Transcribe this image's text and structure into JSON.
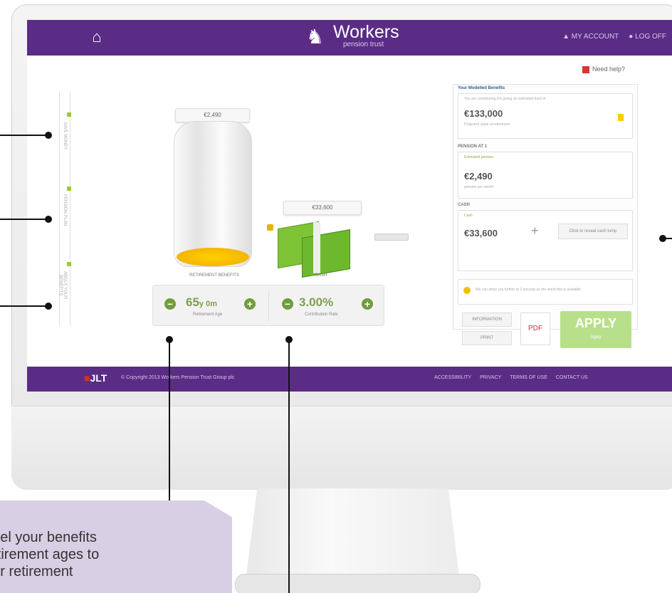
{
  "header": {
    "home_icon": "home-icon",
    "logo_main": "Workers",
    "logo_sub": "pension trust",
    "my_account": "▲ MY ACCOUNT",
    "log_off": "● LOG OFF"
  },
  "help": {
    "label": "Need help?"
  },
  "sidebar": {
    "items": [
      "SAVE MONEY",
      "PENSION PLAN",
      "ABOUT YOUR BENEFITS"
    ]
  },
  "visual": {
    "top_box": "€2,490",
    "jar_label": "RETIREMENT BENEFITS",
    "cash_box": "€33,600",
    "cash_label": "CASH"
  },
  "controls": {
    "retirement_age": "65",
    "retirement_age_suffix": "y 0m",
    "retirement_age_label": "Retirement Age",
    "contribution_rate": "3.00%",
    "contribution_rate_label": "Contribution Rate"
  },
  "right_panel": {
    "title": "Your Modelled Benefits",
    "projection_label": "You are contributing 3% giving an estimated fund of",
    "projection_value": "€133,000",
    "projection_note": "Projected value at retirement",
    "section2_label": "PENSION AT 1",
    "section2_sub": "Estimated pension",
    "pension_value": "€2,490",
    "pension_note": "pension per month",
    "cash_section": "CASH",
    "cash_sub": "Cash",
    "cash_value": "€33,600",
    "lump_sum_btn": "Click to reveal cash lump",
    "info_text": "We can show you further at 3 and pay as the sheet this is available",
    "btn_1": "INFORMATION",
    "btn_2": "PRINT",
    "pdf_label": "PDF",
    "apply": "APPLY",
    "apply_sub": "Apply"
  },
  "footer": {
    "jlt": "JLT",
    "copyright": "© Copyright 2013 Workers Pension Trust Group plc",
    "links": [
      "ACCESSIBILITY",
      "PRIVACY",
      "TERMS OF USE",
      "CONTACT US"
    ]
  },
  "tooltip": {
    "line_1": "odel your benefits",
    "line_2": "retirement ages to",
    "line_3": "our retirement"
  }
}
